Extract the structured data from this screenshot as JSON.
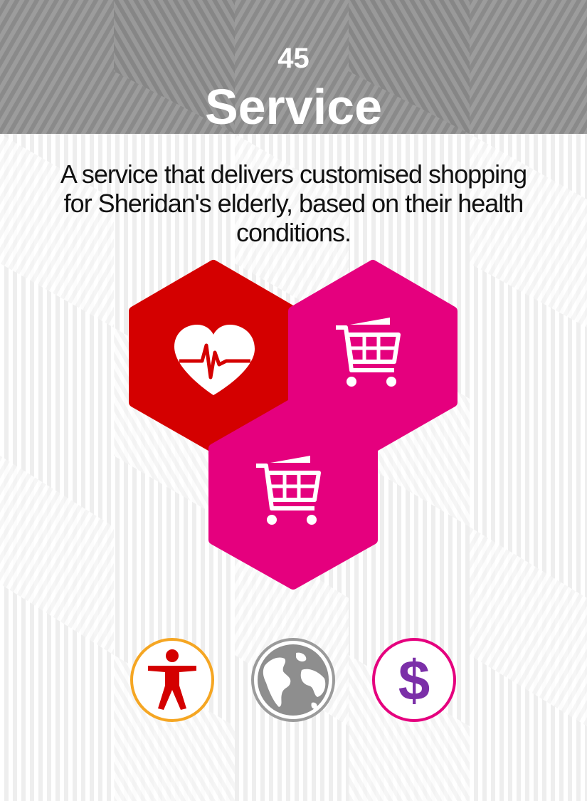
{
  "card": {
    "number": "45",
    "title": "Service",
    "description": "A service that delivers customised shopping for Sheridan's elderly, based on their health conditions."
  },
  "tiles": [
    {
      "icon": "heart-rate-icon",
      "color": "#d40000"
    },
    {
      "icon": "shopping-cart-icon",
      "color": "#e5007e"
    },
    {
      "icon": "shopping-cart-icon",
      "color": "#e5007e"
    }
  ],
  "badges": [
    {
      "icon": "person-accessibility-icon",
      "ring_color": "#f5a623",
      "icon_color": "#d40000"
    },
    {
      "icon": "globe-icon",
      "ring_color": "#9b9b9b",
      "icon_color": "#8e8e8e"
    },
    {
      "icon": "dollar-icon",
      "ring_color": "#e5007e",
      "icon_color": "#7b2fa8"
    }
  ]
}
